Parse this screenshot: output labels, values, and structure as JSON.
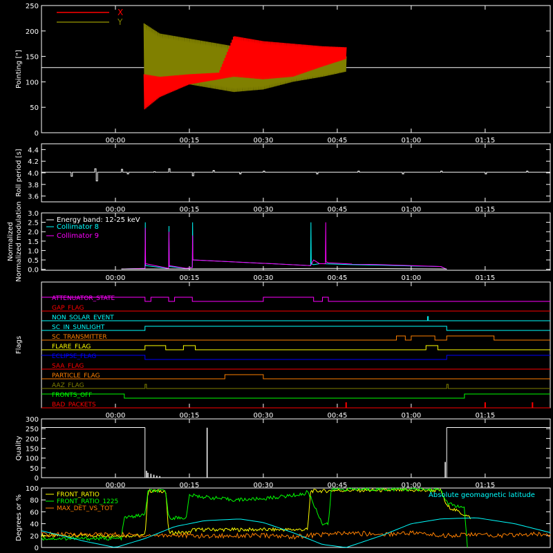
{
  "chart_data": [
    {
      "type": "line",
      "ylabel": "Pointing [\"]",
      "ylim": [
        0,
        250
      ],
      "yticks": [
        0,
        50,
        100,
        150,
        200,
        250
      ],
      "xlim": [
        -0.25,
        1.47
      ],
      "xticks": [
        "00:00",
        "00:15",
        "00:30",
        "00:45",
        "01:00",
        "01:15"
      ],
      "xtick_hours": [
        0,
        0.25,
        0.5,
        0.75,
        1.0,
        1.25
      ],
      "legend_position": "top-left",
      "series": [
        {
          "name": "X",
          "color": "#ff0000",
          "x": [
            0.097,
            0.15,
            0.25,
            0.35,
            0.4,
            0.5,
            0.6,
            0.7,
            0.78
          ],
          "ymin": [
            45,
            70,
            95,
            105,
            110,
            105,
            110,
            130,
            145
          ],
          "ymax": [
            115,
            110,
            115,
            118,
            190,
            180,
            175,
            170,
            168
          ]
        },
        {
          "name": "Y",
          "color": "#808000",
          "x": [
            0.097,
            0.15,
            0.25,
            0.35,
            0.4,
            0.5,
            0.6,
            0.7,
            0.78
          ],
          "ymin": [
            95,
            100,
            95,
            85,
            80,
            85,
            100,
            110,
            120
          ],
          "ymax": [
            215,
            195,
            185,
            175,
            170,
            165,
            160,
            155,
            150
          ]
        }
      ],
      "baseline": 128
    },
    {
      "type": "line",
      "ylabel": "Roll period [s]",
      "ylim": [
        3.5,
        4.5
      ],
      "yticks": [
        3.6,
        3.8,
        4.0,
        4.2,
        4.4
      ],
      "xlim": [
        -0.25,
        1.47
      ],
      "xticks": [
        "00:00",
        "00:15",
        "00:30",
        "00:45",
        "01:00",
        "01:15"
      ],
      "xtick_hours": [
        0,
        0.25,
        0.5,
        0.75,
        1.0,
        1.25
      ],
      "series": [
        {
          "name": "",
          "color": "#ffffff",
          "base": 4.01,
          "spikes": [
            [
              -0.15,
              3.94
            ],
            [
              -0.07,
              4.07
            ],
            [
              -0.065,
              3.86
            ],
            [
              0.02,
              4.06
            ],
            [
              0.04,
              3.98
            ],
            [
              0.13,
              4.02
            ],
            [
              0.18,
              4.07
            ],
            [
              0.26,
              3.95
            ],
            [
              0.33,
              4.04
            ],
            [
              0.42,
              3.98
            ],
            [
              0.5,
              4.03
            ],
            [
              0.68,
              3.98
            ],
            [
              0.82,
              4.03
            ],
            [
              0.97,
              3.98
            ],
            [
              1.1,
              4.03
            ],
            [
              1.25,
              3.98
            ],
            [
              1.39,
              4.03
            ]
          ]
        }
      ]
    },
    {
      "type": "line",
      "ylabel": "Normalized modulation",
      "ylim": [
        -0.05,
        3.0
      ],
      "yticks": [
        0.0,
        0.5,
        1.0,
        1.5,
        2.0,
        2.5,
        3.0
      ],
      "xlim": [
        -0.25,
        1.47
      ],
      "xticks": [
        "00:00",
        "00:15",
        "00:30",
        "00:45",
        "01:00",
        "01:15"
      ],
      "xtick_hours": [
        0,
        0.25,
        0.5,
        0.75,
        1.0,
        1.25
      ],
      "annotation": "Energy band: 12-25 keV",
      "legend_position": "top-left",
      "series": [
        {
          "name": "Collimator 8",
          "color": "#00ffff",
          "x": [
            0.02,
            0.1,
            0.101,
            0.102,
            0.18,
            0.181,
            0.182,
            0.24,
            0.26,
            0.261,
            0.262,
            0.66,
            0.661,
            0.662,
            0.67,
            0.69,
            0.7,
            0.8,
            0.9,
            1.0,
            1.1,
            1.12
          ],
          "y": [
            0.02,
            0.05,
            2.5,
            0.2,
            0.05,
            2.3,
            0.15,
            0.05,
            0.1,
            2.5,
            0.5,
            0.2,
            2.5,
            0.3,
            0.25,
            0.3,
            0.3,
            0.25,
            0.22,
            0.18,
            0.15,
            0.0
          ]
        },
        {
          "name": "Collimator 9",
          "color": "#ff00ff",
          "x": [
            0.02,
            0.1,
            0.101,
            0.102,
            0.18,
            0.181,
            0.182,
            0.24,
            0.26,
            0.261,
            0.262,
            0.66,
            0.67,
            0.69,
            0.71,
            0.711,
            0.712,
            0.72,
            0.8,
            0.9,
            1.0,
            1.1,
            1.12
          ],
          "y": [
            0.02,
            0.05,
            2.2,
            0.3,
            0.05,
            2.0,
            0.2,
            0.05,
            0.1,
            1.8,
            0.5,
            0.2,
            0.5,
            0.3,
            0.3,
            2.5,
            0.4,
            0.35,
            0.28,
            0.25,
            0.2,
            0.15,
            0.0
          ]
        },
        {
          "name": "",
          "color": "#ffffff",
          "x": [
            0.02,
            0.5,
            0.7,
            0.9,
            1.12
          ],
          "y": [
            0.02,
            0.03,
            0.05,
            0.04,
            0.02
          ]
        }
      ]
    },
    {
      "type": "line",
      "ylabel": "Flags",
      "xlim": [
        -0.25,
        1.47
      ],
      "xticks": [
        "00:00",
        "00:15",
        "00:30",
        "00:45",
        "01:00",
        "01:15"
      ],
      "xtick_hours": [
        0,
        0.25,
        0.5,
        0.75,
        1.0,
        1.25
      ],
      "series": [
        {
          "name": "ATTENUATOR_STATE",
          "color": "#ff00ff",
          "high": [
            [
              -0.25,
              0.1
            ],
            [
              0.12,
              0.18
            ],
            [
              0.2,
              0.26
            ],
            [
              0.5,
              0.67
            ],
            [
              0.7,
              0.72
            ]
          ]
        },
        {
          "name": "GAP_FLAG",
          "color": "#ff0000",
          "high": []
        },
        {
          "name": "NON_SOLAR_EVENT",
          "color": "#00ffff",
          "high": [
            [
              1.055,
              1.058
            ]
          ]
        },
        {
          "name": "SC_IN_SUNLIGHT",
          "color": "#00ffff",
          "high": [
            [
              0.1,
              1.12
            ]
          ]
        },
        {
          "name": "SC_TRANSMITTER",
          "color": "#ff8000",
          "high": [
            [
              0.95,
              0.98
            ],
            [
              1.0,
              1.08
            ],
            [
              1.12,
              1.28
            ]
          ]
        },
        {
          "name": "FLARE_FLAG",
          "color": "#ffff00",
          "high": [
            [
              0.1,
              0.17
            ],
            [
              0.23,
              0.27
            ],
            [
              1.05,
              1.09
            ]
          ]
        },
        {
          "name": "ECLIPSE_FLAG",
          "color": "#0000ff",
          "high": [
            [
              -0.25,
              0.1
            ],
            [
              1.12,
              1.47
            ]
          ]
        },
        {
          "name": "SAA_FLAG",
          "color": "#ff0000",
          "high": []
        },
        {
          "name": "PARTICLE_FLAG",
          "color": "#ff8000",
          "high": [
            [
              0.37,
              0.5
            ]
          ]
        },
        {
          "name": "AAZ_FLAG",
          "color": "#808000",
          "high": [
            [
              0.1,
              0.105
            ],
            [
              1.12,
              1.125
            ]
          ]
        },
        {
          "name": "FRONTS_OFF",
          "color": "#00ff00",
          "high": [
            [
              -0.25,
              0.03
            ],
            [
              1.18,
              1.47
            ]
          ]
        },
        {
          "name": "BAD_PACKETS",
          "color": "#ff0000",
          "spikes": [
            0.78,
            1.25,
            1.41
          ]
        }
      ]
    },
    {
      "type": "line",
      "ylabel": "Quality",
      "ylim": [
        0,
        300
      ],
      "yticks": [
        0,
        50,
        100,
        150,
        200,
        250,
        300
      ],
      "xlim": [
        -0.25,
        1.47
      ],
      "xticks": [
        "00:00",
        "00:15",
        "00:30",
        "00:45",
        "01:00",
        "01:15"
      ],
      "xtick_hours": [
        0,
        0.25,
        0.5,
        0.75,
        1.0,
        1.25
      ],
      "series": [
        {
          "name": "",
          "color": "#ffffff",
          "segments": [
            [
              -0.25,
              0.1,
              256
            ],
            [
              1.12,
              1.47,
              256
            ]
          ],
          "spikes": [
            [
              0.105,
              35
            ],
            [
              0.11,
              25
            ],
            [
              0.12,
              20
            ],
            [
              0.13,
              15
            ],
            [
              0.14,
              10
            ],
            [
              0.15,
              8
            ],
            [
              0.31,
              255
            ],
            [
              1.115,
              80
            ]
          ]
        }
      ]
    },
    {
      "type": "line",
      "ylabel": "Degrees or %",
      "ylim": [
        0,
        100
      ],
      "yticks": [
        0,
        20,
        40,
        60,
        80,
        100
      ],
      "xlim": [
        -0.25,
        1.47
      ],
      "legend_position": "top-left",
      "series": [
        {
          "name": "FRONT_RATIO",
          "color": "#ffff00",
          "x": [
            -0.25,
            0.1,
            0.11,
            0.17,
            0.18,
            0.25,
            0.26,
            0.65,
            0.66,
            0.72,
            0.73,
            1.1,
            1.12,
            1.2
          ],
          "y": [
            20,
            20,
            95,
            95,
            25,
            25,
            30,
            30,
            95,
            95,
            96,
            96,
            70,
            50
          ]
        },
        {
          "name": "FRONT_RATIO_1225",
          "color": "#00ff00",
          "x": [
            -0.25,
            0.02,
            0.03,
            0.1,
            0.11,
            0.17,
            0.18,
            0.24,
            0.25,
            0.3,
            0.4,
            0.5,
            0.64,
            0.65,
            0.7,
            0.72,
            0.73,
            0.9,
            1.0,
            1.1,
            1.12,
            1.18,
            1.19
          ],
          "y": [
            15,
            15,
            50,
            55,
            95,
            95,
            50,
            50,
            88,
            85,
            80,
            82,
            90,
            95,
            40,
            40,
            98,
            98,
            98,
            97,
            75,
            65,
            0
          ]
        },
        {
          "name": "MAX_DET_VS_TOT",
          "color": "#ff8000",
          "x": [
            -0.25,
            0.0,
            0.1,
            0.2,
            0.3,
            0.4,
            0.5,
            0.6,
            0.7,
            0.8,
            0.9,
            1.0,
            1.1,
            1.2,
            1.3,
            1.4,
            1.47
          ],
          "y": [
            22,
            22,
            20,
            21,
            19,
            20,
            20,
            18,
            22,
            24,
            22,
            25,
            20,
            22,
            20,
            22,
            22
          ]
        },
        {
          "name": "Absolute geomagnetic latitude",
          "color": "#00ffff",
          "x": [
            -0.25,
            -0.1,
            0.0,
            0.1,
            0.2,
            0.3,
            0.42,
            0.5,
            0.6,
            0.7,
            0.78,
            0.9,
            1.0,
            1.1,
            1.22,
            1.35,
            1.47
          ],
          "y": [
            28,
            10,
            0,
            15,
            35,
            45,
            48,
            42,
            25,
            5,
            0,
            20,
            40,
            48,
            50,
            40,
            25
          ]
        }
      ]
    }
  ]
}
